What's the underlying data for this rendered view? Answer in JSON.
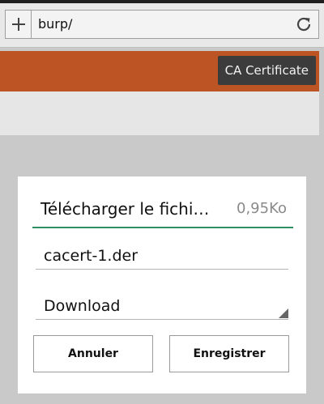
{
  "browser": {
    "url": "burp/",
    "new_tab_icon": "plus-icon",
    "reload_icon": "reload-icon"
  },
  "page": {
    "header_button_label": "CA Certificate",
    "accent_color": "#bc5423"
  },
  "download_dialog": {
    "title": "Télécharger le fichi…",
    "file_size": "0,95Ko",
    "filename_value": "cacert-1.der",
    "folder_selected": "Download",
    "cancel_label": "Annuler",
    "save_label": "Enregistrer",
    "underline_color": "#2f8f64"
  }
}
